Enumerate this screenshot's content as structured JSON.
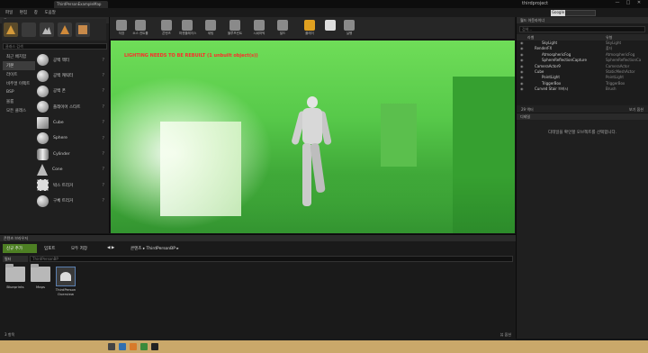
{
  "window": {
    "doc_tab": "ThirdPersonExampleMap",
    "project": "thirdproject",
    "min": "—",
    "max": "□",
    "close": "✕"
  },
  "menu": [
    "파일",
    "편집",
    "창",
    "도움말"
  ],
  "search_top": {
    "button": "Google",
    "placeholder": ""
  },
  "left_panel": {
    "tab": "모드",
    "search_placeholder": "클래스 검색",
    "categories": [
      "최근 배치함",
      "기본",
      "라이트",
      "비주얼 이펙트",
      "BSP",
      "볼륨",
      "모든 클래스"
    ],
    "selected_category": 1,
    "assets": [
      "공백 액터",
      "공백 캐릭터",
      "공백 폰",
      "플레이어 스타트",
      "Cube",
      "Sphere",
      "Cylinder",
      "Cone",
      "박스 트리거",
      "구체 트리거"
    ],
    "help": "?"
  },
  "toolbar": {
    "buttons": [
      "저장",
      "소스 컨트롤",
      "콘텐츠",
      "마켓플레이스",
      "세팅",
      "블루프린트",
      "시네마틱",
      "빌드",
      "플레이",
      "실행"
    ]
  },
  "viewport": {
    "warning": "LIGHTING NEEDS TO BE REBUILT (1 unbuilt object(s))"
  },
  "outliner": {
    "tab": "월드 아웃라이너",
    "search_placeholder": "검색...",
    "col_label": "라벨",
    "col_type": "유형",
    "rows": [
      {
        "name": "SkyLight",
        "type": "SkyLight"
      },
      {
        "name": "RenderFX",
        "type": "폴더"
      },
      {
        "name": "AtmosphericFog",
        "type": "AtmosphericFog"
      },
      {
        "name": "SphereReflectionCapture",
        "type": "SphereReflectionCa"
      },
      {
        "name": "CameraActor9",
        "type": "CameraActor"
      },
      {
        "name": "Cube",
        "type": "StaticMeshActor"
      },
      {
        "name": "PointLight",
        "type": "PointLight"
      },
      {
        "name": "TriggerBox",
        "type": "TriggerBox"
      },
      {
        "name": "Curved Stair 브러시",
        "type": "Brush"
      }
    ],
    "count": "29 액터",
    "view_options": "보기 옵션"
  },
  "details": {
    "tab": "디테일",
    "message": "디테일을 확인할 오브젝트를 선택합니다."
  },
  "content_browser": {
    "tab": "콘텐츠 브라우저",
    "add_new": "신규 추가",
    "import": "임포트",
    "save_all": "모두 저장",
    "breadcrumb": [
      "콘텐츠",
      "ThirdPersonBP"
    ],
    "filter": "필터",
    "search_placeholder": "ThirdPersonBP",
    "items": [
      "Blueprints",
      "Maps",
      "ThirdPerson Overview"
    ],
    "count": "3 항목",
    "view_options": "뷰 옵션"
  },
  "colors": {
    "accent": "#e0a020",
    "viewport_green": "#57c94a",
    "add_new_green": "#4d7f23"
  }
}
